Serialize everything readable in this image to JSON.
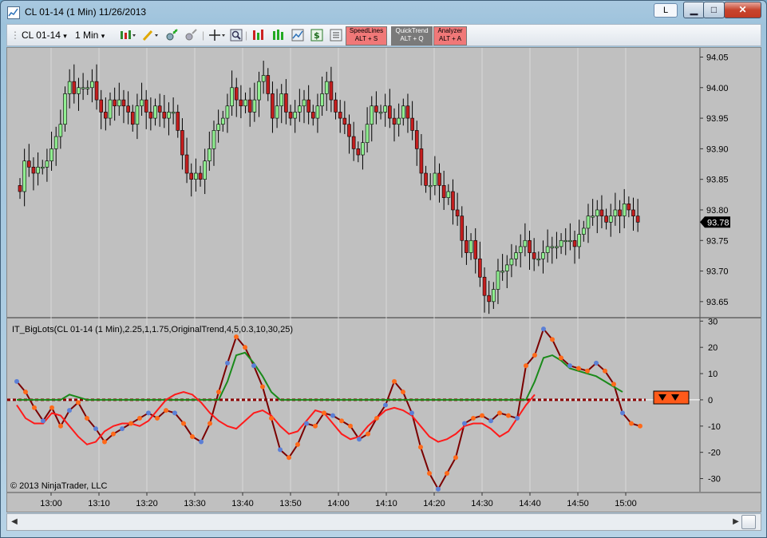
{
  "window": {
    "title": "CL 01-14 (1 Min)  11/26/2013",
    "link_button": "L",
    "min_glyph": "▁",
    "max_glyph": "□",
    "close_glyph": "✕",
    "icon": "chart-window-icon"
  },
  "toolbar": {
    "instrument": "CL 01-14",
    "interval": "1 Min",
    "dropdown_glyph": "▾",
    "icons": [
      "bar-type-icon",
      "drawing-pencil-icon",
      "zoom-in-icon",
      "zoom-out-icon",
      "crosshair-icon",
      "zoom-box-icon",
      "indicators-icon",
      "strategies-icon",
      "data-series-icon",
      "cash-icon",
      "properties-icon"
    ],
    "hotkeys": [
      {
        "name": "SpeedLines",
        "key": "ALT + S",
        "color": "#f07878"
      },
      {
        "name": "QuickTrend",
        "key": "ALT + Q",
        "color": "#7a7a7a"
      },
      {
        "name": "Analyzer",
        "key": "ALT + A",
        "color": "#f07878"
      }
    ]
  },
  "chart": {
    "copyright": "© 2013 NinjaTrader, LLC",
    "indicator_label": "IT_BigLots(CL 01-14 (1 Min),2.25,1,1.75,OriginalTrend,4,5,0.3,10,30,25)",
    "current_price": "93.78",
    "background": "#c0c0c0",
    "up_color": "#90ee90",
    "down_color": "#c41e1e"
  },
  "chart_data": [
    {
      "type": "candlestick",
      "title": "",
      "x_tick_labels": [
        "13:00",
        "13:10",
        "13:20",
        "13:30",
        "13:40",
        "13:50",
        "14:00",
        "14:10",
        "14:20",
        "14:30",
        "14:40",
        "14:50",
        "15:00"
      ],
      "y_tick_labels": [
        "94.05",
        "94.00",
        "93.95",
        "93.90",
        "93.85",
        "93.80",
        "93.75",
        "93.70",
        "93.65"
      ],
      "ylim": [
        93.625,
        94.065
      ],
      "last_price": 93.78,
      "bar_interval": "1 Min",
      "closes": [
        93.83,
        93.88,
        93.87,
        93.86,
        93.87,
        93.87,
        93.88,
        93.9,
        93.92,
        93.94,
        93.99,
        94.01,
        93.99,
        94.0,
        94.0,
        94.0,
        94.01,
        93.98,
        93.96,
        93.95,
        93.98,
        93.97,
        93.98,
        93.97,
        93.96,
        93.94,
        93.97,
        93.98,
        93.96,
        93.95,
        93.97,
        93.96,
        93.95,
        93.96,
        93.96,
        93.93,
        93.89,
        93.86,
        93.85,
        93.86,
        93.85,
        93.88,
        93.9,
        93.93,
        93.94,
        93.95,
        93.97,
        94.0,
        93.98,
        93.97,
        93.98,
        93.96,
        93.98,
        94.01,
        94.02,
        93.99,
        93.95,
        93.97,
        93.99,
        93.96,
        93.95,
        93.96,
        93.97,
        93.98,
        93.96,
        93.95,
        93.97,
        93.99,
        94.01,
        93.98,
        93.96,
        93.95,
        93.94,
        93.92,
        93.9,
        93.89,
        93.91,
        93.94,
        93.97,
        93.96,
        93.96,
        93.97,
        93.95,
        93.94,
        93.95,
        93.97,
        93.95,
        93.93,
        93.9,
        93.86,
        93.84,
        93.84,
        93.86,
        93.84,
        93.82,
        93.83,
        93.8,
        93.79,
        93.75,
        93.73,
        93.75,
        93.72,
        93.69,
        93.66,
        93.65,
        93.67,
        93.7,
        93.7,
        93.71,
        93.72,
        93.73,
        93.74,
        93.75,
        93.73,
        93.72,
        93.72,
        93.73,
        93.74,
        93.74,
        93.74,
        93.75,
        93.75,
        93.75,
        93.74,
        93.76,
        93.77,
        93.79,
        93.79,
        93.8,
        93.79,
        93.78,
        93.79,
        93.8,
        93.79,
        93.81,
        93.8,
        93.79,
        93.78
      ]
    },
    {
      "type": "line",
      "title": "",
      "x_tick_labels": [
        "13:00",
        "13:10",
        "13:20",
        "13:30",
        "13:40",
        "13:50",
        "14:00",
        "14:10",
        "14:20",
        "14:30",
        "14:40",
        "14:50",
        "15:00"
      ],
      "y_tick_labels": [
        "30",
        "20",
        "10",
        "0",
        "-10",
        "-20",
        "-30"
      ],
      "ylim": [
        -35,
        31
      ],
      "series": [
        {
          "color": "#7a0000",
          "values": [
            7,
            3,
            -3,
            -8,
            -3,
            -10,
            -4,
            -1,
            -7,
            -11,
            -16,
            -13,
            -11,
            -9,
            -7,
            -5,
            -7,
            -4,
            -5,
            -9,
            -14,
            -16,
            -9,
            3,
            14,
            24,
            20,
            13,
            5,
            -7,
            -19,
            -22,
            -17,
            -9,
            -10,
            -5,
            -6,
            -8,
            -10,
            -15,
            -13,
            -7,
            -2,
            7,
            3,
            -5,
            -18,
            -28,
            -34,
            -28,
            -22,
            -9,
            -7,
            -6,
            -8,
            -5,
            -6,
            -7,
            13,
            17,
            27,
            23,
            16,
            13,
            12,
            11,
            14,
            11,
            6,
            -5,
            -9,
            -10
          ]
        },
        {
          "color": "#1a8a1a",
          "values": [
            0,
            0,
            0,
            0,
            0,
            0,
            2,
            1,
            0,
            0,
            0,
            0,
            0,
            0,
            0,
            0,
            0,
            0,
            0,
            0,
            0,
            0,
            0,
            0,
            7,
            17,
            18,
            14,
            9,
            3,
            0,
            0,
            0,
            0,
            0,
            0,
            0,
            0,
            0,
            0,
            0,
            0,
            0,
            0,
            0,
            0,
            0,
            0,
            0,
            0,
            0,
            0,
            0,
            0,
            0,
            0,
            0,
            0,
            0,
            7,
            16,
            17,
            15,
            12,
            11,
            10,
            9,
            7,
            5,
            3
          ]
        },
        {
          "color": "#ff1a1a",
          "values": [
            -2,
            -7,
            -9,
            -9,
            -5,
            -6,
            -10,
            -14,
            -17,
            -16,
            -12,
            -10,
            -9,
            -9,
            -10,
            -8,
            -4,
            0,
            2,
            3,
            2,
            -1,
            -5,
            -8,
            -10,
            -11,
            -8,
            -5,
            -4,
            -6,
            -10,
            -13,
            -12,
            -8,
            -4,
            -5,
            -9,
            -13,
            -15,
            -14,
            -10,
            -7,
            -4,
            -3,
            -4,
            -6,
            -10,
            -14,
            -16,
            -15,
            -13,
            -10,
            -9,
            -9,
            -11,
            -14,
            -12,
            -7,
            -2,
            2
          ]
        }
      ]
    }
  ]
}
